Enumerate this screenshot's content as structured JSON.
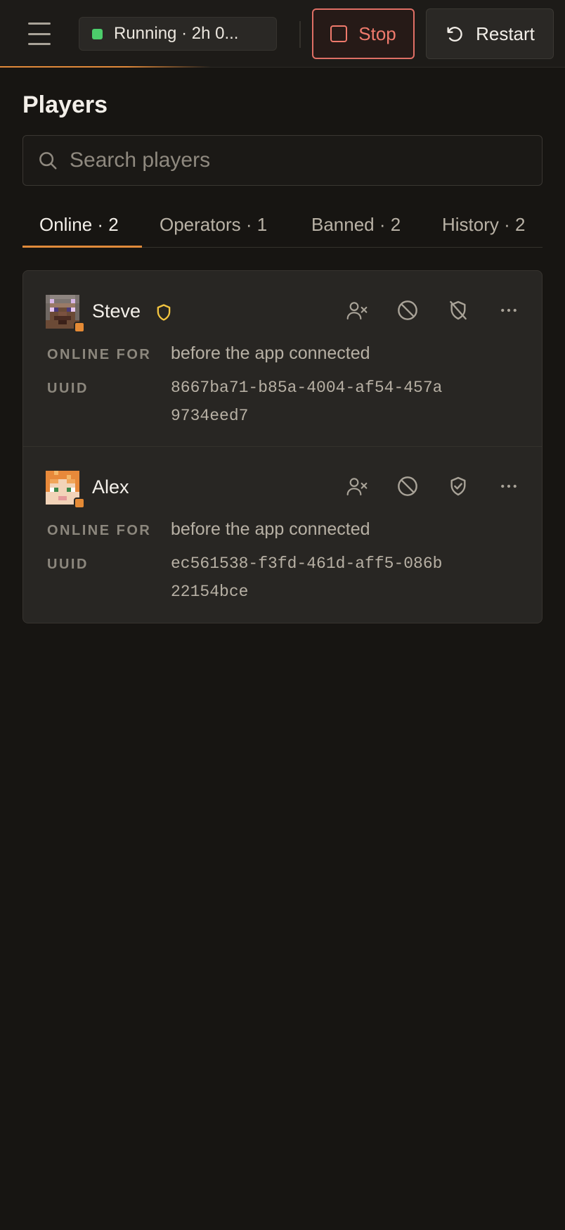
{
  "topbar": {
    "status_text": "Running · 2h 0...",
    "status_color": "#4ccd6b",
    "stop_label": "Stop",
    "restart_label": "Restart",
    "accent_color": "#e08a3a"
  },
  "page": {
    "title": "Players"
  },
  "search": {
    "placeholder": "Search players",
    "value": ""
  },
  "tabs": [
    {
      "label": "Online · 2",
      "active": true
    },
    {
      "label": "Operators · 1",
      "active": false
    },
    {
      "label": "Banned · 2",
      "active": false
    },
    {
      "label": "History · 2",
      "active": false
    }
  ],
  "labels": {
    "online_for": "ONLINE FOR",
    "uuid": "UUID"
  },
  "players": [
    {
      "name": "Steve",
      "is_operator": true,
      "online_for": "before the app connected",
      "uuid": "8667ba71-b85a-4004-af54-457a9734eed7",
      "actions": [
        "kick-user-icon",
        "ban-icon",
        "revoke-op-icon",
        "more-icon"
      ]
    },
    {
      "name": "Alex",
      "is_operator": false,
      "online_for": "before the app connected",
      "uuid": "ec561538-f3fd-461d-aff5-086b22154bce",
      "actions": [
        "kick-user-icon",
        "ban-icon",
        "grant-op-icon",
        "more-icon"
      ]
    }
  ]
}
